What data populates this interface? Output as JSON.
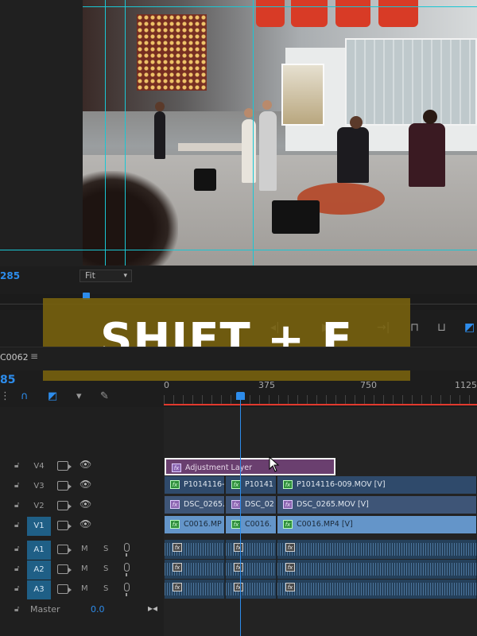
{
  "program_monitor": {
    "timecode": "285",
    "zoom_select": "Fit"
  },
  "caption": {
    "text": "SHIFT + E"
  },
  "sequence": {
    "name": "C0062",
    "timecode": "85",
    "ruler_labels": [
      "0",
      "375",
      "750",
      "1125"
    ]
  },
  "tracks": {
    "video": [
      {
        "label": "V4",
        "targeted": false
      },
      {
        "label": "V3",
        "targeted": false
      },
      {
        "label": "V2",
        "targeted": false
      },
      {
        "label": "V1",
        "targeted": true
      }
    ],
    "audio": [
      {
        "label": "A1",
        "targeted": true
      },
      {
        "label": "A2",
        "targeted": true
      },
      {
        "label": "A3",
        "targeted": true
      }
    ],
    "master": {
      "label": "Master",
      "value": "0.0"
    },
    "mute_label": "M",
    "solo_label": "S"
  },
  "clips": {
    "v4": [
      {
        "name": "Adjustment Layer"
      }
    ],
    "v3": [
      {
        "name": "P1014116-"
      },
      {
        "name": "P10141"
      },
      {
        "name": "P1014116-009.MOV [V]"
      }
    ],
    "v2": [
      {
        "name": "DSC_0265."
      },
      {
        "name": "DSC_02"
      },
      {
        "name": "DSC_0265.MOV [V]"
      }
    ],
    "v1": [
      {
        "name": "C0016.MP"
      },
      {
        "name": "C0016."
      },
      {
        "name": "C0016.MP4 [V]"
      }
    ]
  },
  "icons": {
    "fx_label": "fx"
  },
  "colors": {
    "accent_blue": "#2d8ceb",
    "guide_cyan": "#19c7d4",
    "caption_bg": "#78620e",
    "adjustment_clip": "#6a3f6f",
    "work_area": "#e23a2e"
  }
}
